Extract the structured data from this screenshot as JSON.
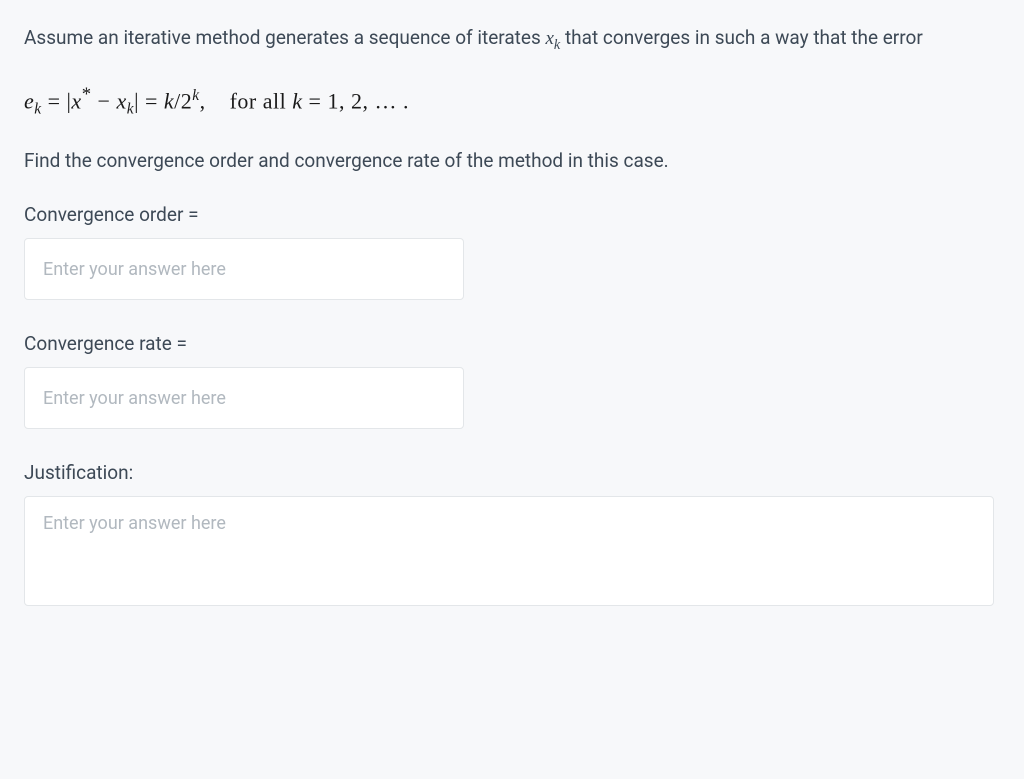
{
  "question": {
    "intro_part1": "Assume an iterative method  generates a sequence of iterates ",
    "intro_var": "x",
    "intro_sub": "k",
    "intro_part2": " that converges in such a way that the error",
    "math_display_text": "e_k = |x* − x_k| = k/2^k,    for all k = 1, 2, … .",
    "instruction": "Find the convergence order and convergence rate of the method in this case."
  },
  "fields": {
    "order": {
      "label": "Convergence order =",
      "placeholder": "Enter your answer here",
      "value": ""
    },
    "rate": {
      "label": "Convergence rate =",
      "placeholder": "Enter your answer here",
      "value": ""
    },
    "justification": {
      "label": "Justification:",
      "placeholder": "Enter your answer here",
      "value": ""
    }
  }
}
